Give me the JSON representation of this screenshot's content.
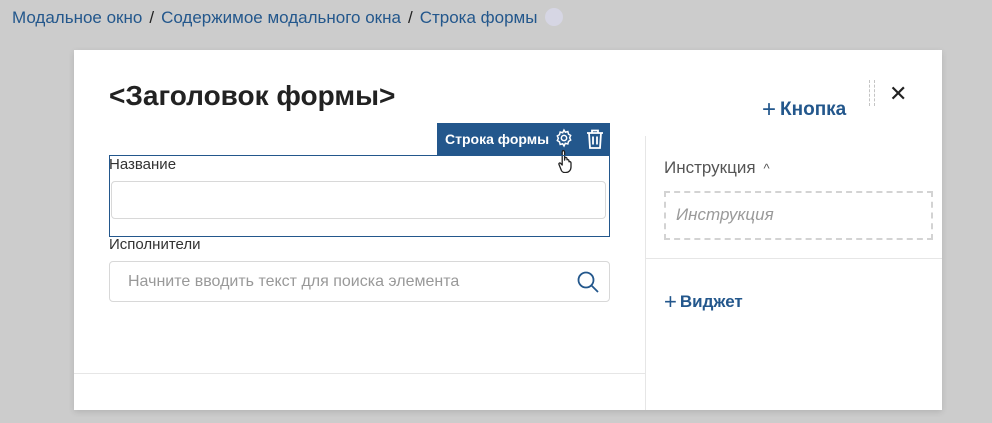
{
  "breadcrumb": {
    "items": [
      "Модальное окно",
      "Содержимое модального окна",
      "Строка формы"
    ],
    "separator": "/"
  },
  "modal": {
    "title": "<Заголовок формы>",
    "add_button_label": "Кнопка",
    "close_icon": "close-icon",
    "form_row_toolbar": {
      "label": "Строка формы",
      "icons": [
        "gear-icon",
        "trash-icon"
      ],
      "color": "#23578c"
    },
    "fields": {
      "name_label": "Название",
      "name_value": "",
      "assignees_label": "Исполнители",
      "assignees_placeholder": "Начните вводить текст для поиска элемента"
    },
    "sidebar": {
      "instruction_header": "Инструкция",
      "instruction_placeholder": "Инструкция",
      "add_widget_label": "Виджет"
    }
  },
  "colors": {
    "accent": "#23578c",
    "background": "#cccccc"
  }
}
